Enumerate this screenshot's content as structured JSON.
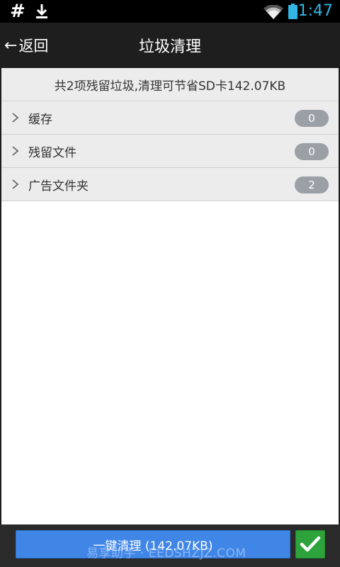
{
  "status_bar": {
    "hash_symbol": "#",
    "time": "1:47",
    "icons": [
      "hash-icon",
      "download-icon",
      "wifi-icon",
      "battery-icon"
    ]
  },
  "header": {
    "back_label": "返回",
    "title": "垃圾清理"
  },
  "summary": "共2项残留垃圾,清理可节省SD卡142.07KB",
  "categories": [
    {
      "label": "缓存",
      "count": "0"
    },
    {
      "label": "残留文件",
      "count": "0"
    },
    {
      "label": "广告文件夹",
      "count": "2"
    }
  ],
  "footer": {
    "clean_label": "一键清理 (142.07KB)",
    "watermark": "易享助手 · EEDSHZJZ.COM"
  },
  "colors": {
    "accent": "#33b5e5",
    "button_blue": "#3f86e6",
    "button_green": "#2ea33b",
    "badge": "#9aa0a6"
  }
}
